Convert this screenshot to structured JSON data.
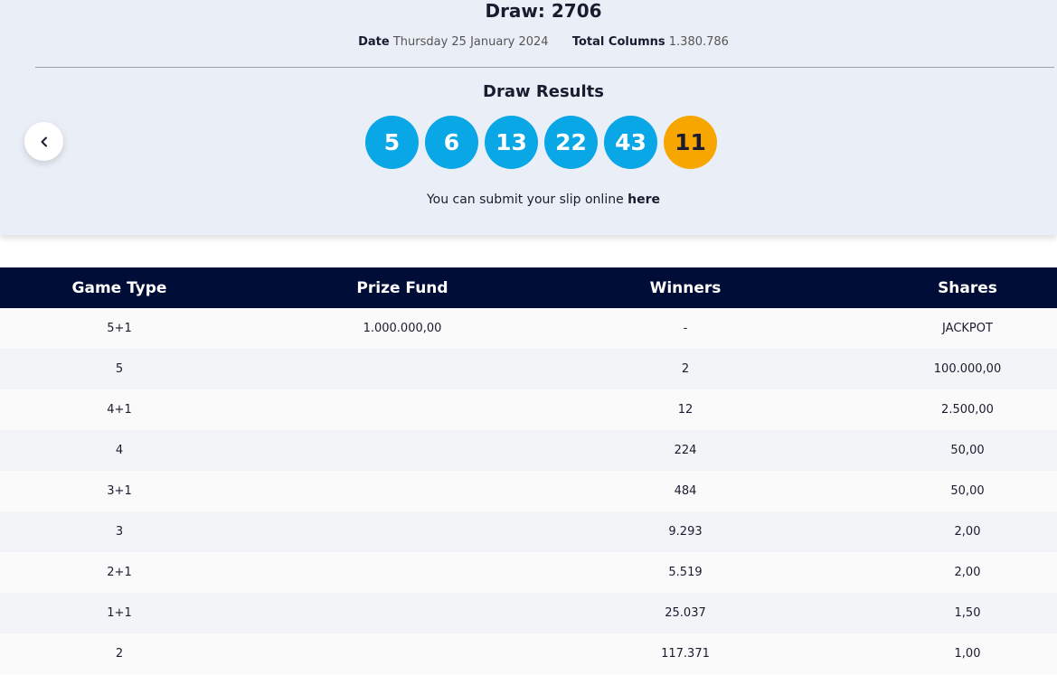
{
  "header": {
    "draw_label": "Draw: 2706",
    "date_label": "Date",
    "date_value": "Thursday 25 January 2024",
    "columns_label": "Total Columns",
    "columns_value": "1.380.786",
    "results_title": "Draw Results",
    "prev_icon": "chevron-left-icon"
  },
  "numbers": {
    "main": [
      "5",
      "6",
      "13",
      "22",
      "43"
    ],
    "bonus": "11",
    "colors": {
      "main": "#0aa7e6",
      "bonus": "#f7a600"
    }
  },
  "slip": {
    "text": "You can submit your slip online",
    "link": "here"
  },
  "table": {
    "headers": [
      "Game Type",
      "Prize Fund",
      "Winners",
      "Shares"
    ],
    "rows": [
      [
        "5+1",
        "1.000.000,00",
        "-",
        "JACKPOT"
      ],
      [
        "5",
        "",
        "2",
        "100.000,00"
      ],
      [
        "4+1",
        "",
        "12",
        "2.500,00"
      ],
      [
        "4",
        "",
        "224",
        "50,00"
      ],
      [
        "3+1",
        "",
        "484",
        "50,00"
      ],
      [
        "3",
        "",
        "9.293",
        "2,00"
      ],
      [
        "2+1",
        "",
        "5.519",
        "2,00"
      ],
      [
        "1+1",
        "",
        "25.037",
        "1,50"
      ],
      [
        "2",
        "",
        "117.371",
        "1,00"
      ]
    ],
    "header_color": "#000d36"
  }
}
